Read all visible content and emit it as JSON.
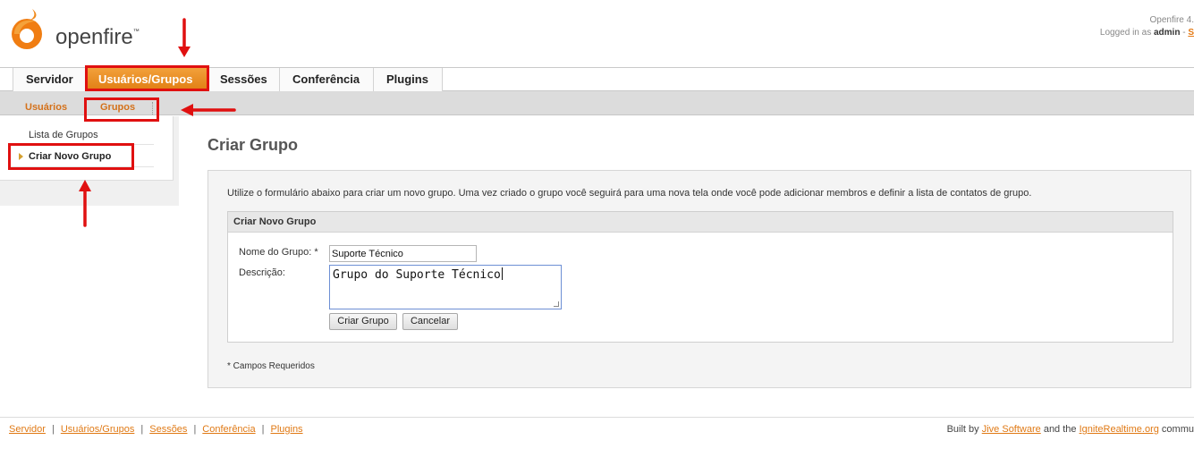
{
  "header": {
    "logo_text": "openfire",
    "logo_tm": "™",
    "version_text": "Openfire 4.",
    "logged_prefix": "Logged in as",
    "user": "admin",
    "logged_sep": " - ",
    "logout_link": "S"
  },
  "tabs": [
    {
      "label": "Servidor"
    },
    {
      "label": "Usuários/Grupos"
    },
    {
      "label": "Sessões"
    },
    {
      "label": "Conferência"
    },
    {
      "label": "Plugins"
    }
  ],
  "subtabs": [
    {
      "label": "Usuários"
    },
    {
      "label": "Grupos"
    }
  ],
  "sidebar": {
    "items": [
      {
        "label": "Lista de Grupos"
      },
      {
        "label": "Criar Novo Grupo"
      }
    ]
  },
  "main": {
    "title": "Criar Grupo",
    "intro": "Utilize o formulário abaixo para criar um novo grupo. Uma vez criado o grupo você seguirá para uma nova tela onde você pode adicionar membros e definir a lista de contatos de grupo.",
    "form": {
      "heading": "Criar Novo Grupo",
      "name_label": "Nome do Grupo: *",
      "name_value": "Suporte Técnico",
      "desc_label": "Descrição:",
      "desc_value": "Grupo do Suporte Técnico",
      "create_button": "Criar Grupo",
      "cancel_button": "Cancelar"
    },
    "required_note": "* Campos Requeridos"
  },
  "footer": {
    "links": [
      "Servidor",
      "Usuários/Grupos",
      "Sessões",
      "Conferência",
      "Plugins"
    ],
    "separator": "|",
    "built_prefix": "Built by ",
    "jive_link": "Jive Software",
    "built_middle": " and the ",
    "ignite_link": "IgniteRealtime.org",
    "built_suffix": " commu"
  },
  "colors": {
    "accent": "#e07d12",
    "link": "#e07a16",
    "annotation": "#e01010"
  }
}
